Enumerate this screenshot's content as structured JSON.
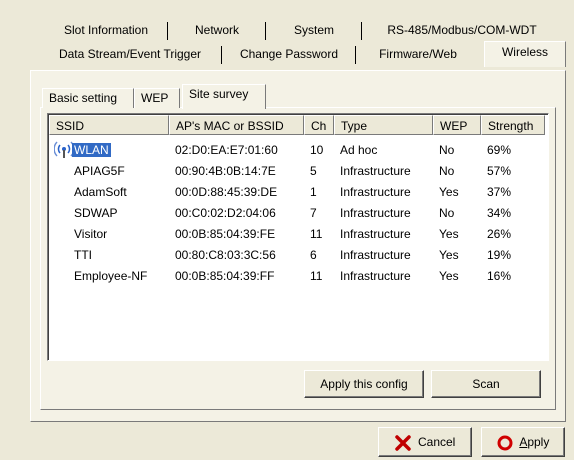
{
  "tabs": {
    "row1": [
      "Slot Information",
      "Network",
      "System",
      "RS-485/Modbus/COM-WDT"
    ],
    "row2": [
      "Data Stream/Event Trigger",
      "Change Password",
      "Firmware/Web",
      "Wireless"
    ],
    "active": "Wireless"
  },
  "inner_tabs": {
    "items": [
      "Basic setting",
      "WEP",
      "Site survey"
    ],
    "active": "Site survey"
  },
  "survey": {
    "columns": [
      "SSID",
      "AP's MAC or BSSID",
      "Ch",
      "Type",
      "WEP",
      "Strength"
    ],
    "rows": [
      {
        "ssid": "WLAN",
        "mac": "02:D0:EA:E7:01:60",
        "ch": "10",
        "type": "Ad hoc",
        "wep": "No",
        "strength": "69%"
      },
      {
        "ssid": "APIAG5F",
        "mac": "00:90:4B:0B:14:7E",
        "ch": "5",
        "type": "Infrastructure",
        "wep": "No",
        "strength": "57%"
      },
      {
        "ssid": "AdamSoft",
        "mac": "00:0D:88:45:39:DE",
        "ch": "1",
        "type": "Infrastructure",
        "wep": "Yes",
        "strength": "37%"
      },
      {
        "ssid": "SDWAP",
        "mac": "00:C0:02:D2:04:06",
        "ch": "7",
        "type": "Infrastructure",
        "wep": "No",
        "strength": "34%"
      },
      {
        "ssid": "Visitor",
        "mac": "00:0B:85:04:39:FE",
        "ch": "11",
        "type": "Infrastructure",
        "wep": "Yes",
        "strength": "26%"
      },
      {
        "ssid": "TTI",
        "mac": "00:80:C8:03:3C:56",
        "ch": "6",
        "type": "Infrastructure",
        "wep": "Yes",
        "strength": "19%"
      },
      {
        "ssid": "Employee-NF",
        "mac": "00:0B:85:04:39:FF",
        "ch": "11",
        "type": "Infrastructure",
        "wep": "Yes",
        "strength": "16%"
      }
    ],
    "selected_ssid": "WLAN",
    "selected_icon": "wireless-signal-icon"
  },
  "buttons": {
    "apply_config": "Apply this config",
    "scan": "Scan",
    "cancel": "Cancel",
    "cancel_icon": "red-x-icon",
    "apply_prefix": "",
    "apply_underlined": "A",
    "apply_rest": "pply",
    "apply_icon": "red-circle-icon"
  },
  "colors": {
    "selection": "#316ac5",
    "dialog_bg": "#ece9d8",
    "cancel_icon": "#c00000",
    "apply_icon": "#d00000"
  }
}
